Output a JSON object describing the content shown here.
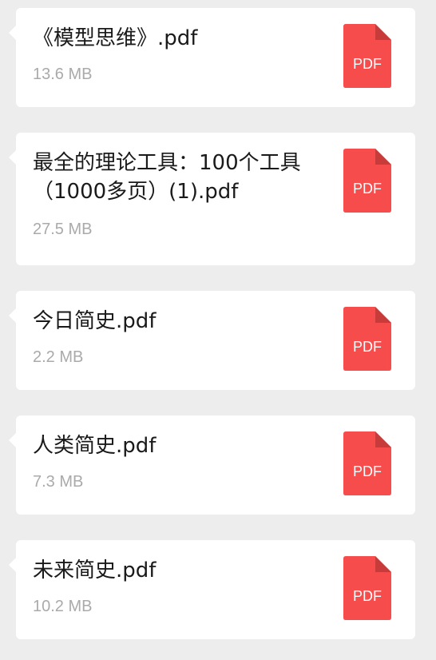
{
  "colors": {
    "background": "#ededed",
    "card": "#ffffff",
    "pdf_icon": "#f74c4c",
    "pdf_fold": "#c73b3b",
    "name_text": "#1a1a1a",
    "size_text": "#aaaaaa"
  },
  "files": [
    {
      "name": "《模型思维》.pdf",
      "size": "13.6 MB",
      "icon_label": "PDF",
      "icon": "pdf-file-icon"
    },
    {
      "name": "最全的理论工具：100个工具（1000多页）(1).pdf",
      "size": "27.5 MB",
      "icon_label": "PDF",
      "icon": "pdf-file-icon"
    },
    {
      "name": "今日简史.pdf",
      "size": "2.2 MB",
      "icon_label": "PDF",
      "icon": "pdf-file-icon"
    },
    {
      "name": "人类简史.pdf",
      "size": "7.3 MB",
      "icon_label": "PDF",
      "icon": "pdf-file-icon"
    },
    {
      "name": "未来简史.pdf",
      "size": "10.2 MB",
      "icon_label": "PDF",
      "icon": "pdf-file-icon"
    }
  ]
}
